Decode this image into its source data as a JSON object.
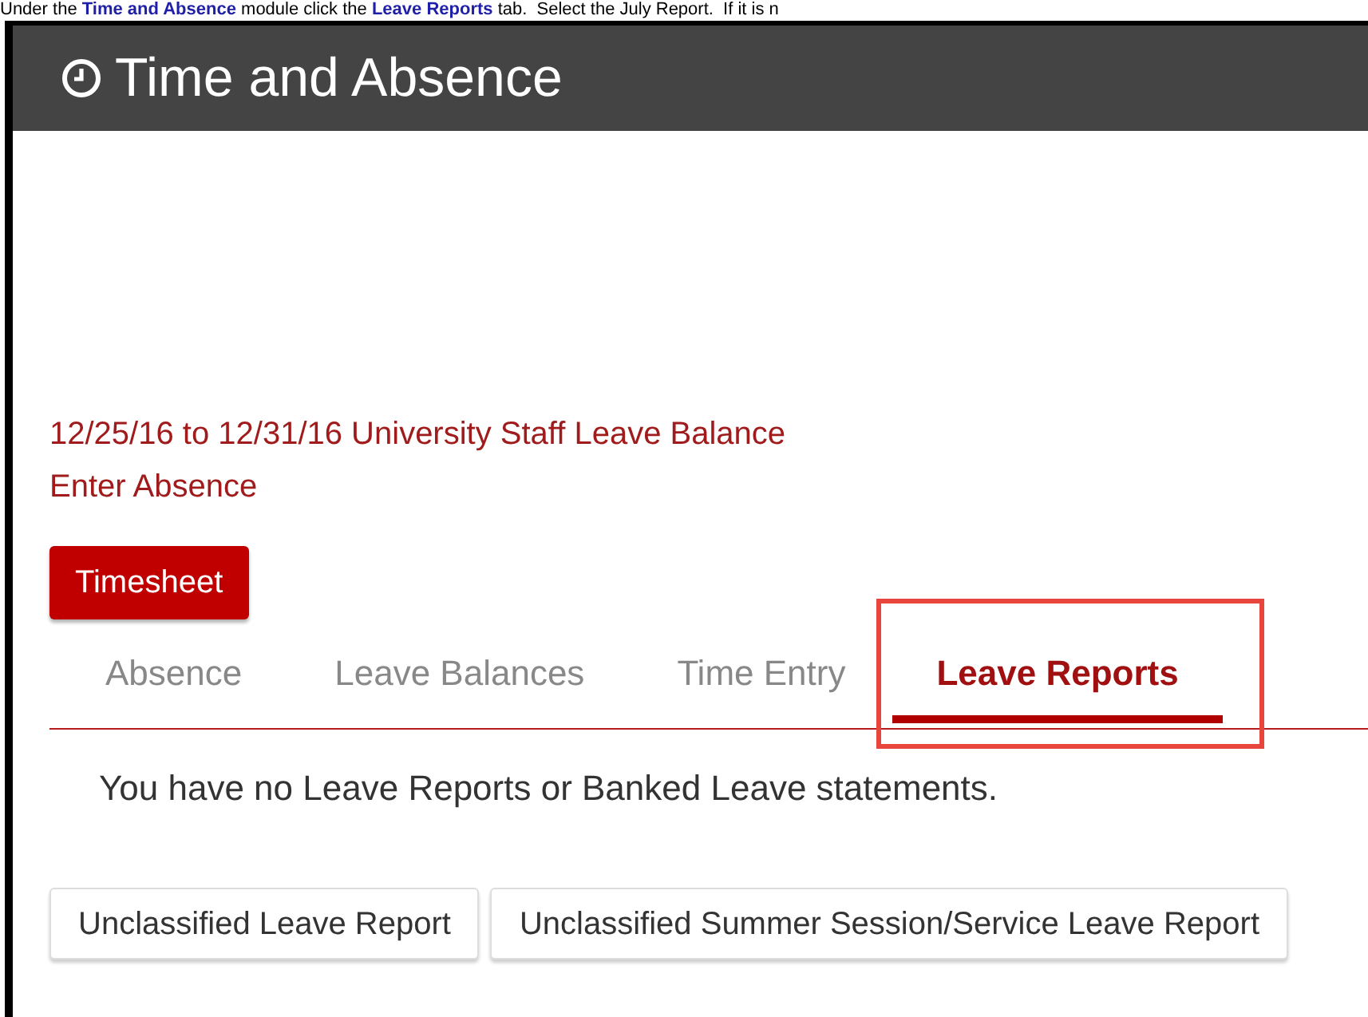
{
  "caption": [
    {
      "kind": "text",
      "text": "Under the "
    },
    {
      "kind": "link",
      "text": "Time and Absence"
    },
    {
      "kind": "text",
      "text": " module click the "
    },
    {
      "kind": "link",
      "text": "Leave Reports"
    },
    {
      "kind": "text",
      "text": " tab.  Select the July Report.  If it is n"
    }
  ],
  "window": {
    "title": "Time and Absence"
  },
  "links": [
    "12/25/16 to 12/31/16 University Staff Leave Balance",
    "Enter Absence"
  ],
  "primary_button": "Timesheet",
  "tabs": [
    {
      "label": "Absence",
      "selected": false
    },
    {
      "label": "Leave Balances",
      "selected": false
    },
    {
      "label": "Time Entry",
      "selected": false
    },
    {
      "label": "Leave Reports",
      "selected": true
    }
  ],
  "message": "You have no Leave Reports or Banked Leave statements.",
  "buttons": [
    "Unclassified Leave Report",
    "Unclassified Summer Session/Service Leave Report"
  ]
}
